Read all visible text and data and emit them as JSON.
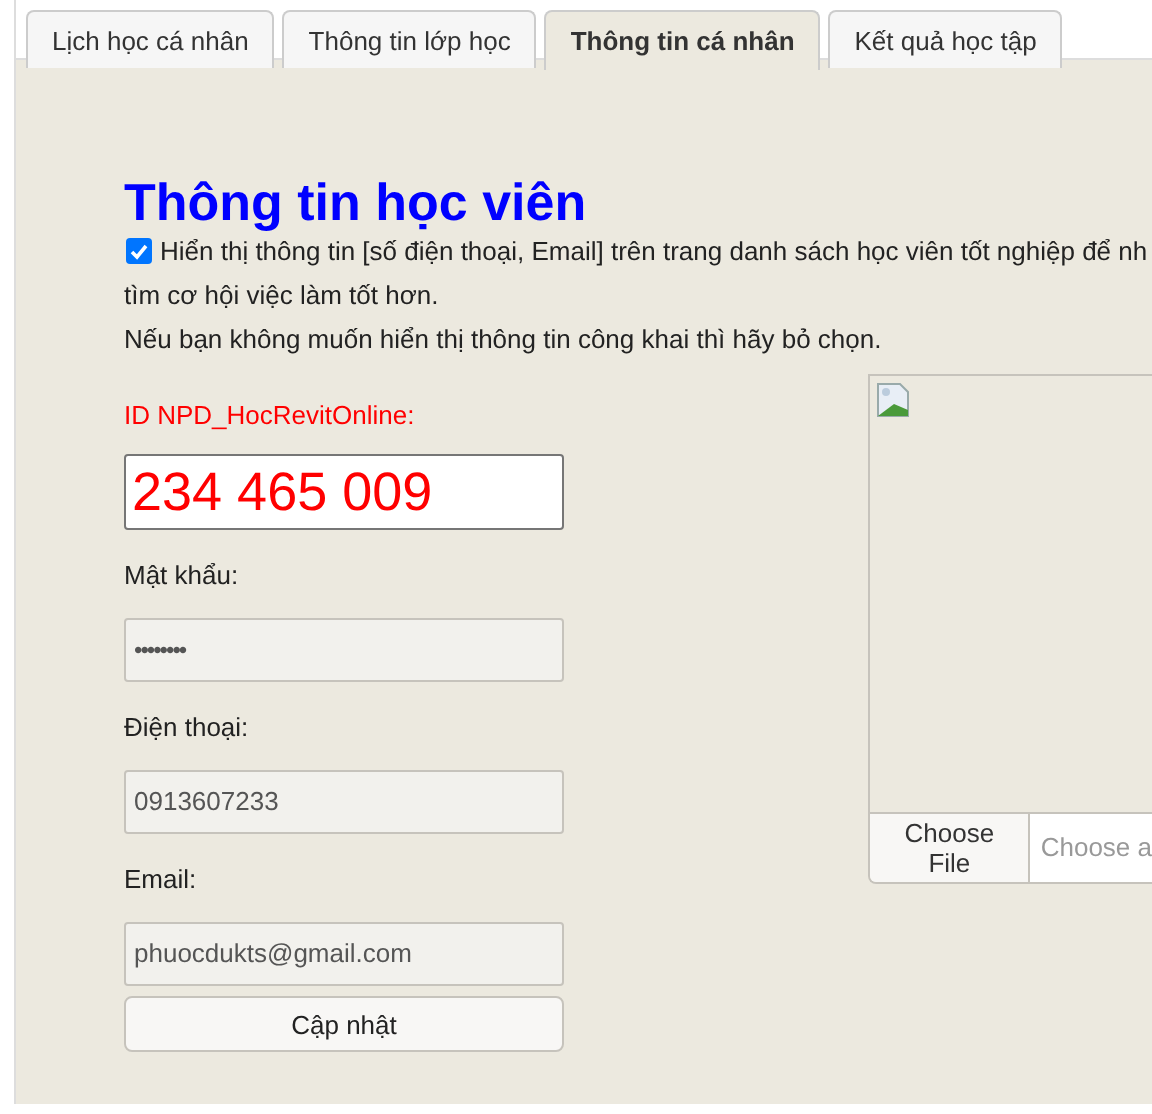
{
  "tabs": [
    {
      "label": "Lịch học cá nhân",
      "selected": false
    },
    {
      "label": "Thông tin lớp học",
      "selected": false
    },
    {
      "label": "Thông tin cá nhân",
      "selected": true
    },
    {
      "label": "Kết quả học tập",
      "selected": false
    }
  ],
  "title": "Thông tin học viên",
  "consent": {
    "checked": true,
    "text": "Hiển thị thông tin [số điện thoại, Email] trên trang danh sách học viên tốt nghiệp để nh",
    "text_2": "tìm cơ hội việc làm tốt hơn.",
    "note": "Nếu bạn không muốn hiển thị thông tin công khai thì hãy bỏ chọn."
  },
  "id_field": {
    "label": "ID NPD_HocRevitOnline:",
    "value": "234 465 009"
  },
  "fields": [
    {
      "label": "Mật khẩu:",
      "value": "••••••••",
      "kind": "password"
    },
    {
      "label": "Điện thoại:",
      "value": "0913607233",
      "kind": "text"
    },
    {
      "label": "Email:",
      "value": "phuocdukts@gmail.com",
      "kind": "text"
    }
  ],
  "submit": "Cập nhật",
  "photo": {
    "button": "Choose File",
    "placeholder": "Choose a"
  }
}
